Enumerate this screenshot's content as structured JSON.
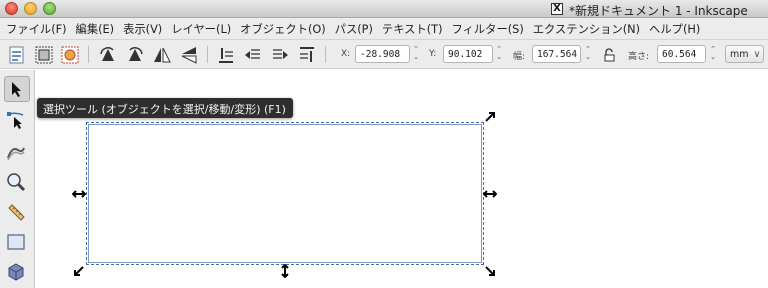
{
  "window": {
    "title": "*新規ドキュメント 1 - Inkscape",
    "icon_glyph": "X"
  },
  "menu": [
    {
      "label": "ファイル(F)"
    },
    {
      "label": "編集(E)"
    },
    {
      "label": "表示(V)"
    },
    {
      "label": "レイヤー(L)"
    },
    {
      "label": "オブジェクト(O)"
    },
    {
      "label": "パス(P)"
    },
    {
      "label": "テキスト(T)"
    },
    {
      "label": "フィルター(S)"
    },
    {
      "label": "エクステンション(N)"
    },
    {
      "label": "ヘルプ(H)"
    }
  ],
  "controls": {
    "x_label": "X:",
    "x_value": "-28.908",
    "y_label": "Y:",
    "y_value": "90.102",
    "w_label": "幅:",
    "w_value": "167.564",
    "h_label": "高さ:",
    "h_value": "60.564",
    "unit": "mm",
    "unit_arrow": "∨"
  },
  "toolbox": {
    "tools": [
      "selector-tool",
      "node-tool",
      "tweak-tool",
      "zoom-tool",
      "measure-tool",
      "rectangle-tool",
      "3d-box-tool"
    ]
  },
  "tooltip": {
    "text": "選択ツール (オブジェクトを選択/移動/変形) (F1)"
  },
  "colors": {
    "selection_dash": "#3a6fb0",
    "tooltip_bg": "#2e2e2e"
  }
}
